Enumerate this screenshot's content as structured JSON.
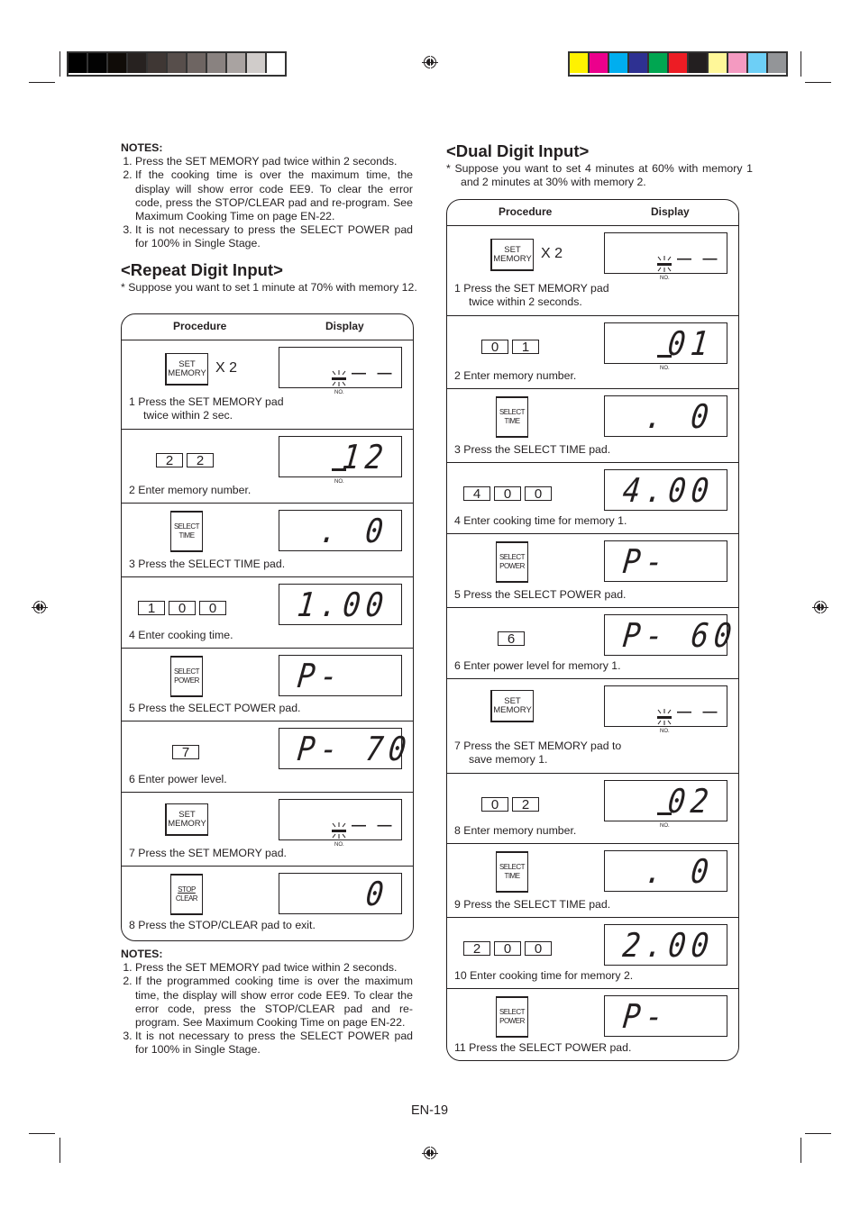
{
  "print_marks": {
    "grayscale_bar": [
      "#000000",
      "#030303",
      "#100c08",
      "#272220",
      "#3f3734",
      "#574e4b",
      "#6e6562",
      "#898280",
      "#a9a3a1",
      "#d0ccca",
      "#ffffff"
    ],
    "color_bar": [
      "#fff200",
      "#ec008c",
      "#00aeef",
      "#2e3192",
      "#00a651",
      "#ed1c24",
      "#231f20",
      "#fff799",
      "#f49ac1",
      "#6dcff6",
      "#939598"
    ]
  },
  "left_column": {
    "top_notes": {
      "title": "NOTES:",
      "items": [
        "Press the SET MEMORY pad twice within 2 seconds.",
        "If the cooking time is over the maximum time, the display will show error code EE9. To clear the error code, press the STOP/CLEAR pad and re-program. See Maximum Cooking Time on page EN-22.",
        "It is not necessary to press the SELECT POWER pad for 100% in Single Stage."
      ]
    },
    "section_title": "<Repeat Digit Input>",
    "intro": "*   Suppose you want to set 1 minute at 70% with memory 12.",
    "table": {
      "header_procedure": "Procedure",
      "header_display": "Display",
      "steps": [
        {
          "pad": "SET\nMEMORY",
          "pad_label_1": "SET",
          "pad_label_2": "MEMORY",
          "multiplier": "X 2",
          "caption_1": "1  Press the SET MEMORY pad",
          "caption_2": "twice within 2 sec.",
          "display": "-- NO.",
          "display_kind": "memory-blink",
          "no_label": "NO."
        },
        {
          "keys": [
            "2",
            "2"
          ],
          "caption_1": "2  Enter memory number.",
          "display": "12",
          "display_kind": "memory-number",
          "no_label": "NO."
        },
        {
          "pad_label_1": "SELECT",
          "pad_label_2": "TIME",
          "caption_1": "3  Press the SELECT TIME pad.",
          "display": ". 0"
        },
        {
          "keys": [
            "1",
            "0",
            "0"
          ],
          "caption_1": "4  Enter cooking time.",
          "display": "1.00"
        },
        {
          "pad_label_1": "SELECT",
          "pad_label_2": "POWER",
          "caption_1": "5  Press the SELECT POWER pad.",
          "display": "P-"
        },
        {
          "keys": [
            "7"
          ],
          "caption_1": "6  Enter power level.",
          "display": "P- 70"
        },
        {
          "pad_label_1": "SET",
          "pad_label_2": "MEMORY",
          "caption_1": "7  Press the SET MEMORY pad.",
          "display": "--",
          "display_kind": "memory-blink",
          "no_label": "NO."
        },
        {
          "pad_label_1": "STOP",
          "pad_label_2": "CLEAR",
          "caption_1": "8  Press the STOP/CLEAR pad to exit.",
          "display": "0"
        }
      ]
    },
    "bottom_notes": {
      "title": "NOTES:",
      "items": [
        "Press the SET MEMORY pad twice within 2 seconds.",
        "If the programmed cooking time is over the maximum time, the display will show error code EE9. To clear the error code, press the STOP/CLEAR pad and re-program. See Maximum Cooking Time on page EN-22.",
        "It is not necessary to press the SELECT POWER pad for 100% in Single Stage."
      ]
    }
  },
  "right_column": {
    "section_title": "<Dual Digit Input>",
    "intro": "*   Suppose you want to set 4 minutes at 60% with memory 1 and 2 minutes at 30% with memory 2.",
    "table": {
      "header_procedure": "Procedure",
      "header_display": "Display",
      "steps": [
        {
          "pad_label_1": "SET",
          "pad_label_2": "MEMORY",
          "multiplier": "X 2",
          "caption_1": "1 Press the SET MEMORY pad",
          "caption_2": "twice within 2 seconds.",
          "display": "--",
          "display_kind": "memory-blink",
          "no_label": "NO."
        },
        {
          "keys": [
            "0",
            "1"
          ],
          "caption_1": "2 Enter memory number.",
          "display": "01",
          "display_kind": "memory-number",
          "no_label": "NO."
        },
        {
          "pad_label_1": "SELECT",
          "pad_label_2": "TIME",
          "caption_1": "3 Press the SELECT TIME pad.",
          "display": ". 0"
        },
        {
          "keys": [
            "4",
            "0",
            "0"
          ],
          "caption_1": "4 Enter cooking time for memory 1.",
          "display": "4.00"
        },
        {
          "pad_label_1": "SELECT",
          "pad_label_2": "POWER",
          "caption_1": "5 Press the SELECT POWER pad.",
          "display": "P-"
        },
        {
          "keys": [
            "6"
          ],
          "caption_1": "6 Enter power level for memory 1.",
          "display": "P- 60"
        },
        {
          "pad_label_1": "SET",
          "pad_label_2": "MEMORY",
          "caption_1": "7 Press the SET MEMORY pad to",
          "caption_2": "save memory 1.",
          "display": "--",
          "display_kind": "memory-blink",
          "no_label": "NO."
        },
        {
          "keys": [
            "0",
            "2"
          ],
          "caption_1": "8 Enter memory number.",
          "display": "02",
          "display_kind": "memory-number",
          "no_label": "NO."
        },
        {
          "pad_label_1": "SELECT",
          "pad_label_2": "TIME",
          "caption_1": "9 Press the SELECT TIME pad.",
          "display": ". 0"
        },
        {
          "keys": [
            "2",
            "0",
            "0"
          ],
          "caption_1": "10  Enter cooking time for memory 2.",
          "display": "2.00"
        },
        {
          "pad_label_1": "SELECT",
          "pad_label_2": "POWER",
          "caption_1": "11  Press the SELECT POWER pad.",
          "display": "P-"
        }
      ]
    }
  },
  "footer": {
    "page_number": "EN-19"
  }
}
